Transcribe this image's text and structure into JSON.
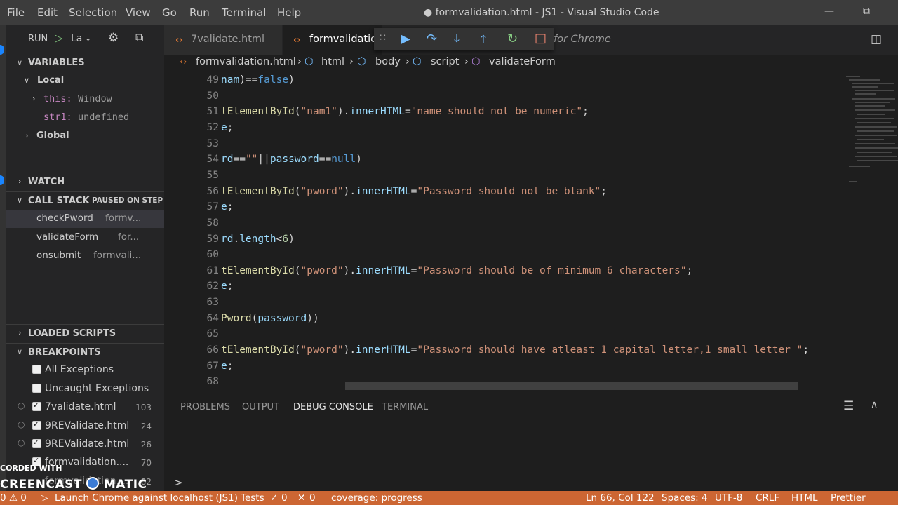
{
  "window": {
    "title": "● formvalidation.html - JS1 - Visual Studio Code",
    "menu": [
      "File",
      "Edit",
      "Selection",
      "View",
      "Go",
      "Run",
      "Terminal",
      "Help"
    ]
  },
  "sidebar": {
    "run_label": "RUN",
    "config_label": "La",
    "variables_header": "VARIABLES",
    "local_label": "Local",
    "this_name": "this:",
    "this_value": "Window",
    "str1_name": "str1:",
    "str1_value": "undefined",
    "global_label": "Global",
    "watch_header": "WATCH",
    "callstack_header": "CALL STACK",
    "paused_label": "PAUSED ON STEP",
    "frames": [
      {
        "name": "checkPword",
        "file": "formv..."
      },
      {
        "name": "validateForm",
        "file": "for..."
      },
      {
        "name": "onsubmit",
        "file": "formvali..."
      }
    ],
    "loaded_scripts_header": "LOADED SCRIPTS",
    "breakpoints_header": "BREAKPOINTS",
    "exceptions": [
      "All Exceptions",
      "Uncaught Exceptions"
    ],
    "breakpoints": [
      {
        "file": "7validate.html",
        "line": "103"
      },
      {
        "file": "9REValidate.html",
        "line": "24"
      },
      {
        "file": "9REValidate.html",
        "line": "26"
      },
      {
        "file": "formvalidation....",
        "line": "70"
      },
      {
        "file": "formvalidation....",
        "line": "82"
      }
    ]
  },
  "tabs": [
    {
      "label": "7validate.html"
    },
    {
      "label": "formvalidatio"
    },
    {
      "label": "for Chrome"
    }
  ],
  "breadcrumb": [
    "formvalidation.html",
    "html",
    "body",
    "script",
    "validateForm"
  ],
  "editor": {
    "lines": [
      {
        "num": "49",
        "tokens": [
          [
            "v",
            "nam"
          ],
          [
            "d",
            ")=="
          ],
          [
            "k",
            "false"
          ],
          [
            "d",
            ")"
          ]
        ]
      },
      {
        "num": "50",
        "tokens": []
      },
      {
        "num": "51",
        "tokens": [
          [
            "f",
            "tElementById"
          ],
          [
            "d",
            "("
          ],
          [
            "s",
            "\"nam1\""
          ],
          [
            "d",
            ")."
          ],
          [
            "v",
            "innerHTML"
          ],
          [
            "d",
            "="
          ],
          [
            "s",
            "\"name should not be numeric\""
          ],
          [
            "d",
            ";"
          ]
        ]
      },
      {
        "num": "52",
        "tokens": [
          [
            "v",
            "e"
          ],
          [
            "d",
            ";"
          ]
        ]
      },
      {
        "num": "53",
        "tokens": []
      },
      {
        "num": "54",
        "tokens": [
          [
            "v",
            "rd"
          ],
          [
            "d",
            "=="
          ],
          [
            "s",
            "\"\""
          ],
          [
            "d",
            "||"
          ],
          [
            "v",
            "password"
          ],
          [
            "d",
            "=="
          ],
          [
            "k",
            "null"
          ],
          [
            "d",
            ")"
          ]
        ]
      },
      {
        "num": "55",
        "tokens": []
      },
      {
        "num": "56",
        "tokens": [
          [
            "f",
            "tElementById"
          ],
          [
            "d",
            "("
          ],
          [
            "s",
            "\"pword\""
          ],
          [
            "d",
            ")."
          ],
          [
            "v",
            "innerHTML"
          ],
          [
            "d",
            "="
          ],
          [
            "s",
            "\"Password should not be blank\""
          ],
          [
            "d",
            ";"
          ]
        ]
      },
      {
        "num": "57",
        "tokens": [
          [
            "v",
            "e"
          ],
          [
            "d",
            ";"
          ]
        ]
      },
      {
        "num": "58",
        "tokens": []
      },
      {
        "num": "59",
        "tokens": [
          [
            "v",
            "rd"
          ],
          [
            "d",
            "."
          ],
          [
            "v",
            "length"
          ],
          [
            "d",
            "<"
          ],
          [
            "n",
            "6"
          ],
          [
            "d",
            ")"
          ]
        ]
      },
      {
        "num": "60",
        "tokens": []
      },
      {
        "num": "61",
        "tokens": [
          [
            "f",
            "tElementById"
          ],
          [
            "d",
            "("
          ],
          [
            "s",
            "\"pword\""
          ],
          [
            "d",
            ")."
          ],
          [
            "v",
            "innerHTML"
          ],
          [
            "d",
            "="
          ],
          [
            "s",
            "\"Password should be of minimum 6 characters\""
          ],
          [
            "d",
            ";"
          ]
        ]
      },
      {
        "num": "62",
        "tokens": [
          [
            "v",
            "e"
          ],
          [
            "d",
            ";"
          ]
        ]
      },
      {
        "num": "63",
        "tokens": []
      },
      {
        "num": "64",
        "tokens": [
          [
            "f",
            "Pword"
          ],
          [
            "d",
            "("
          ],
          [
            "v",
            "password"
          ],
          [
            "d",
            "))"
          ]
        ]
      },
      {
        "num": "65",
        "tokens": []
      },
      {
        "num": "66",
        "tokens": [
          [
            "f",
            "tElementById"
          ],
          [
            "d",
            "("
          ],
          [
            "s",
            "\"pword\""
          ],
          [
            "d",
            ")."
          ],
          [
            "v",
            "innerHTML"
          ],
          [
            "d",
            "="
          ],
          [
            "s",
            "\"Password should have atleast 1 capital letter,1 small letter \""
          ],
          [
            "d",
            ";"
          ]
        ]
      },
      {
        "num": "67",
        "tokens": [
          [
            "v",
            "e"
          ],
          [
            "d",
            ";"
          ]
        ]
      },
      {
        "num": "68",
        "tokens": []
      }
    ]
  },
  "panel": {
    "tabs": [
      "PROBLEMS",
      "OUTPUT",
      "DEBUG CONSOLE",
      "TERMINAL"
    ],
    "active": "DEBUG CONSOLE",
    "prompt": ">"
  },
  "statusbar": {
    "errors": "0",
    "warnings": "0",
    "launch": "Launch Chrome against localhost (JS1)",
    "tests": "Tests",
    "tests_pass": "0",
    "tests_fail": "0",
    "coverage": "coverage: progress",
    "position": "Ln 66, Col 122",
    "spaces": "Spaces: 4",
    "encoding": "UTF-8",
    "eol": "CRLF",
    "language": "HTML",
    "formatter": "Prettier"
  },
  "watermark": {
    "line1": "CORDED WITH",
    "line2a": "CREENCAST",
    "line2b": "MATIC"
  },
  "colors": {
    "statusbar": "#cc6633",
    "editor_bg": "#1e1e1e",
    "sidebar_bg": "#252526"
  }
}
